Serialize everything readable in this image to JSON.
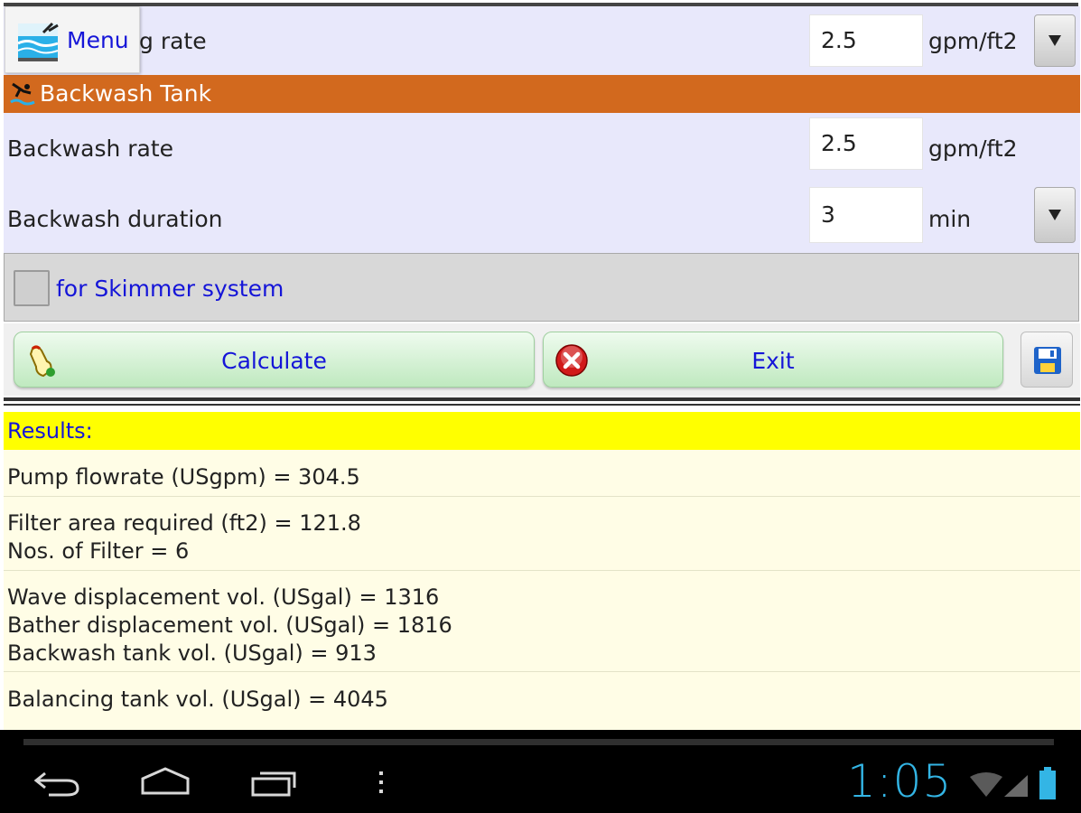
{
  "menu": {
    "label": "Menu",
    "icon": "pool-menu-icon"
  },
  "top_row": {
    "label_fragment": "g rate",
    "value": "2.5",
    "unit": "gpm/ft2"
  },
  "section": {
    "title": "Backwash Tank",
    "icon": "swimmer-icon",
    "color": "#d2691e"
  },
  "backwash_rate": {
    "label": "Backwash rate",
    "value": "2.5",
    "unit": "gpm/ft2"
  },
  "backwash_duration": {
    "label": "Backwash duration",
    "value": "3",
    "unit": "min"
  },
  "skimmer": {
    "label": "for Skimmer system",
    "checked": false
  },
  "buttons": {
    "calculate": "Calculate",
    "exit": "Exit",
    "save_icon": "floppy-disk-icon"
  },
  "results": {
    "header": "Results:",
    "groups": [
      [
        "Pump flowrate (USgpm) = 304.5"
      ],
      [
        "Filter area required (ft2) = 121.8",
        "Nos. of Filter = 6"
      ],
      [
        "Wave displacement vol. (USgal) = 1316",
        "Bather displacement vol. (USgal) = 1816",
        "Backwash tank vol. (USgal) = 913"
      ],
      [
        "Balancing tank vol. (USgal) = 4045"
      ]
    ]
  },
  "status": {
    "time": "1:05"
  },
  "colors": {
    "form_bg": "#e8e8fb",
    "link_blue": "#1515d8",
    "results_yellow": "#ffff00",
    "clock_blue": "#33b5e5"
  }
}
